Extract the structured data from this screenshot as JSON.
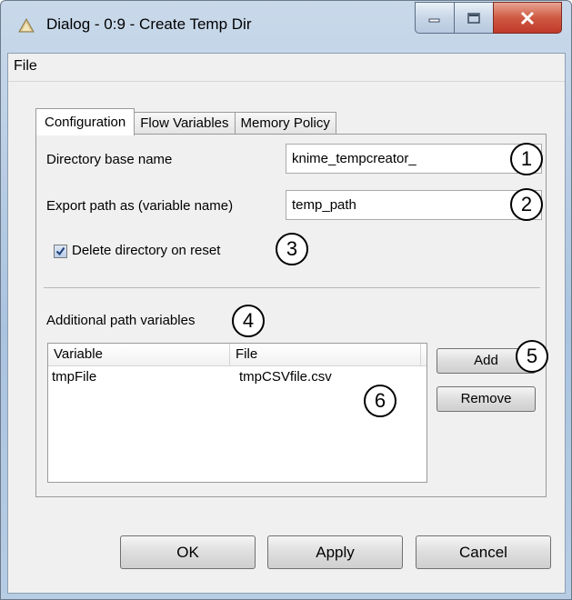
{
  "window": {
    "title": "Dialog - 0:9 - Create Temp Dir",
    "minimize_icon": "minimize-icon",
    "maximize_icon": "maximize-icon",
    "close_icon": "close-icon"
  },
  "menu": {
    "file": "File"
  },
  "tabs": [
    {
      "label": "Configuration",
      "active": true
    },
    {
      "label": "Flow Variables",
      "active": false
    },
    {
      "label": "Memory Policy",
      "active": false
    }
  ],
  "config": {
    "base_name_label": "Directory base name",
    "base_name_value": "knime_tempcreator_",
    "export_label": "Export path as (variable name)",
    "export_value": "temp_path",
    "delete_label": "Delete directory on reset",
    "delete_checked": true,
    "additional_label": "Additional path variables"
  },
  "table": {
    "columns": [
      "Variable",
      "File"
    ],
    "rows": [
      {
        "variable": "tmpFile",
        "file": "tmpCSVfile.csv"
      }
    ]
  },
  "side_buttons": {
    "add": "Add",
    "remove": "Remove"
  },
  "footer_buttons": {
    "ok": "OK",
    "apply": "Apply",
    "cancel": "Cancel"
  },
  "callouts": [
    "1",
    "2",
    "3",
    "4",
    "5",
    "6"
  ]
}
